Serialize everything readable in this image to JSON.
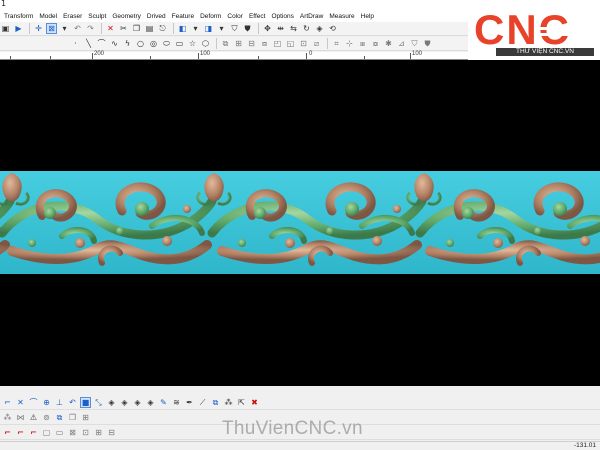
{
  "window": {
    "title_fragment": "1"
  },
  "menu": [
    "Transform",
    "Model",
    "Eraser",
    "Sculpt",
    "Geometry",
    "Drived",
    "Feature",
    "Deform",
    "Color",
    "Effect",
    "Options",
    "ArtDraw",
    "Measure",
    "Help"
  ],
  "ruler": {
    "labels": [
      "200",
      "100",
      "0",
      "100"
    ]
  },
  "status": {
    "coordinate": "-131.01"
  },
  "watermark": {
    "text": "ThuVienCNC.vn"
  },
  "logo": {
    "text": "CNC",
    "subtext": "THƯ VIỆN CNC.VN"
  },
  "colors": {
    "background_relief": "#3cc3d6",
    "leaf_green": "#5fa86a",
    "flower_tan": "#b98a6d",
    "viewport": "#000000",
    "logo_red": "#e8432a"
  }
}
